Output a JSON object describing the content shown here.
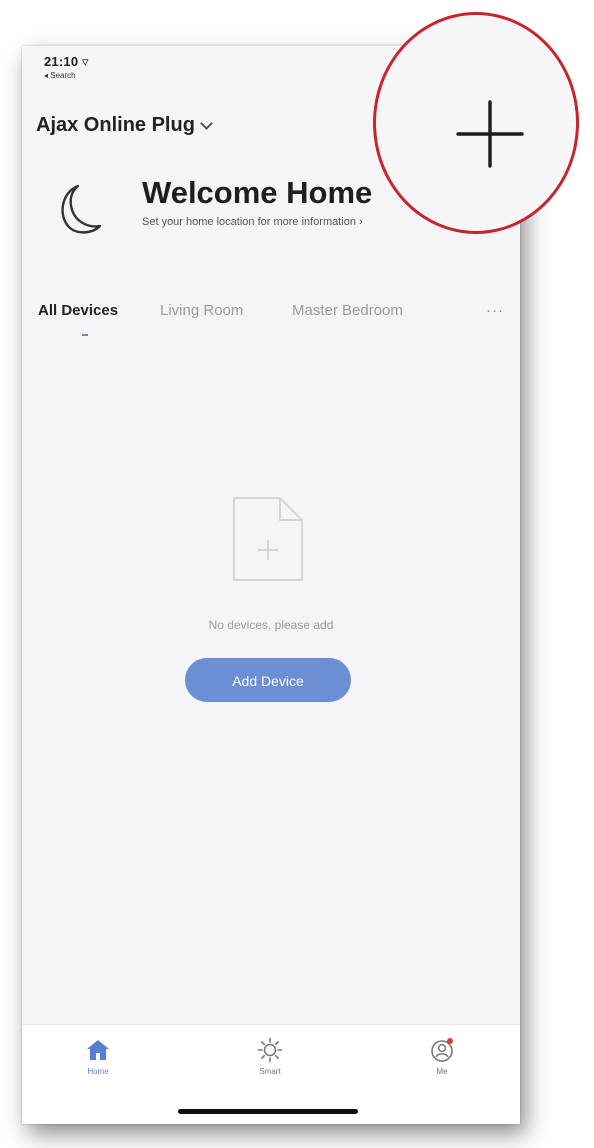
{
  "status_bar": {
    "time": "21:10 ▿",
    "back_label": "◂ Search"
  },
  "header": {
    "home_name": "Ajax Online Plug"
  },
  "welcome": {
    "title": "Welcome Home",
    "subtitle": "Set your home location for more information  ›"
  },
  "tabs": [
    {
      "label": "All Devices",
      "active": true
    },
    {
      "label": "Living Room",
      "active": false
    },
    {
      "label": "Master Bedroom",
      "active": false
    }
  ],
  "tabs_more": "···",
  "empty_state": {
    "message": "No devices, please add",
    "button_label": "Add Device"
  },
  "bottom_nav": [
    {
      "label": "Home",
      "icon": "home-icon",
      "active": true
    },
    {
      "label": "Smart",
      "icon": "sun-icon",
      "active": false
    },
    {
      "label": "Me",
      "icon": "profile-icon",
      "active": false
    }
  ],
  "colors": {
    "accent": "#6a8fd4",
    "callout_ring": "#c8242c",
    "notification_dot": "#e03a3a"
  }
}
